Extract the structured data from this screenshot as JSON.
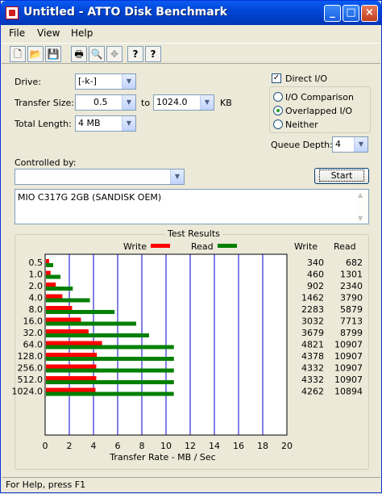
{
  "window": {
    "title": "Untitled - ATTO Disk Benchmark",
    "minimize": "_",
    "maximize": "□",
    "close": "×"
  },
  "menu": [
    "File",
    "View",
    "Help"
  ],
  "toolbar": [
    {
      "name": "new-icon",
      "glyph": "🗋"
    },
    {
      "name": "open-icon",
      "glyph": "📂"
    },
    {
      "name": "save-icon",
      "glyph": "💾"
    },
    {
      "name": "print-icon",
      "glyph": "🖶"
    },
    {
      "name": "print-preview-icon",
      "glyph": "🔍"
    },
    {
      "name": "move-icon",
      "glyph": "✥"
    },
    {
      "name": "help-icon",
      "glyph": "?"
    },
    {
      "name": "context-help-icon",
      "glyph": "?"
    }
  ],
  "form": {
    "drive_label": "Drive:",
    "drive_value": "[-k-]",
    "transfer_size_label": "Transfer Size:",
    "transfer_from": "0.5",
    "to_label": "to",
    "transfer_to": "1024.0",
    "kb_label": "KB",
    "total_length_label": "Total Length:",
    "total_length": "4 MB",
    "direct_io_label": "Direct I/O",
    "direct_io_checked": true,
    "io_comparison_label": "I/O Comparison",
    "overlapped_io_label": "Overlapped I/O",
    "neither_label": "Neither",
    "io_mode": "overlapped",
    "queue_depth_label": "Queue Depth:",
    "queue_depth": "4",
    "controlled_by_label": "Controlled by:",
    "controlled_by_value": "",
    "start_button": "Start",
    "description": "MIO C317G 2GB (SANDISK OEM)"
  },
  "results": {
    "title": "Test Results",
    "write_legend": "Write",
    "read_legend": "Read",
    "write_col": "Write",
    "read_col": "Read",
    "write_color": "#ff0000",
    "read_color": "#008000",
    "grid_color": "#0000cc"
  },
  "chart_data": {
    "type": "bar",
    "orientation": "horizontal",
    "categories": [
      "0.5",
      "1.0",
      "2.0",
      "4.0",
      "8.0",
      "16.0",
      "32.0",
      "64.0",
      "128.0",
      "256.0",
      "512.0",
      "1024.0"
    ],
    "series": [
      {
        "name": "Write",
        "values": [
          340,
          460,
          902,
          1462,
          2283,
          3032,
          3679,
          4821,
          4378,
          4332,
          4332,
          4262
        ]
      },
      {
        "name": "Read",
        "values": [
          682,
          1301,
          2340,
          3790,
          5879,
          7713,
          8799,
          10907,
          10907,
          10907,
          10907,
          10894
        ]
      }
    ],
    "xlabel": "Transfer Rate - MB / Sec",
    "xlim": [
      0,
      20
    ],
    "xticks": [
      "0",
      "2",
      "4",
      "6",
      "8",
      "10",
      "12",
      "14",
      "16",
      "18",
      "20"
    ],
    "grid": true,
    "legend": "top"
  },
  "status": "For Help, press F1"
}
